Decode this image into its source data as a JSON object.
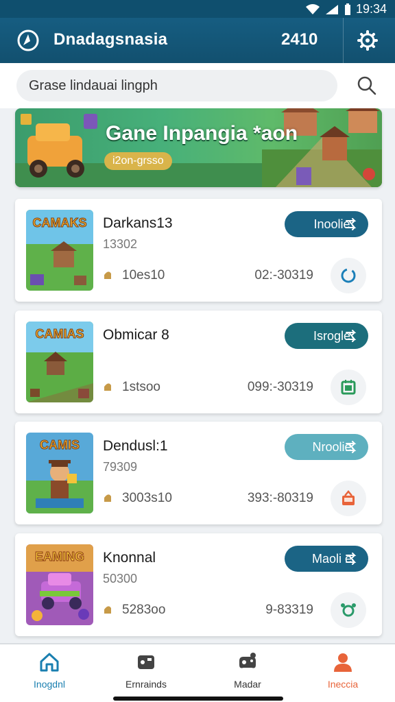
{
  "status_bar": {
    "time": "19:34"
  },
  "app_bar": {
    "title": "Dnadagsnasia",
    "coins": "2410"
  },
  "search": {
    "value": "Grase lindauai lingph"
  },
  "banner": {
    "title": "Gane Inpangia *aon",
    "badge": "i2on-grsso"
  },
  "cards": [
    {
      "name": "Darkans13",
      "sub": "13302",
      "stat": "10es10",
      "time": "02:-30319",
      "button": "Inoolie",
      "button_color": "#1b6485",
      "thumb_title": "CAMAKS",
      "action_icon": "refresh-icon"
    },
    {
      "name": "Obmicar 8",
      "sub": "",
      "stat": "1stsoo",
      "time": "099:-30319",
      "button": "Isrogle",
      "button_color": "#1c6e7c",
      "thumb_title": "CAMIAS",
      "action_icon": "calendar-icon"
    },
    {
      "name": "Dendusl:1",
      "sub": "79309",
      "stat": "3003s10",
      "time": "393:-80319",
      "button": "Nroolie",
      "button_color": "#5eb0bf",
      "thumb_title": "CAMIS",
      "action_icon": "gift-icon"
    },
    {
      "name": "Knonnal",
      "sub": "50300",
      "stat": "5283oo",
      "time": "9-83319",
      "button": "Maoli e",
      "button_color": "#1b6485",
      "thumb_title": "EAMING",
      "action_icon": "share-icon"
    }
  ],
  "bottom_nav": [
    {
      "label": "Inogdnl",
      "icon": "home-icon",
      "active": false,
      "color": "#1a7fb0"
    },
    {
      "label": "Ernrainds",
      "icon": "cards-icon",
      "active": false,
      "color": "#333333"
    },
    {
      "label": "Madar",
      "icon": "gamepad-icon",
      "active": false,
      "color": "#333333"
    },
    {
      "label": "Ineccia",
      "icon": "profile-icon",
      "active": true,
      "color": "#e8643a"
    }
  ],
  "colors": {
    "primary": "#12506f",
    "accent": "#e8643a",
    "nav_active": "#e8643a",
    "nav_home": "#1a7fb0"
  }
}
